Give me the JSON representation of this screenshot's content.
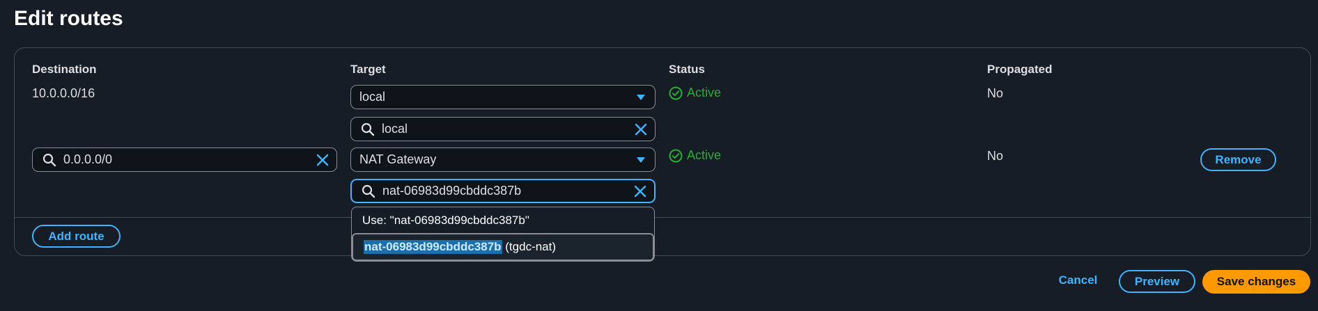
{
  "page": {
    "title": "Edit routes"
  },
  "columns": {
    "destination": "Destination",
    "target": "Target",
    "status": "Status",
    "propagated": "Propagated"
  },
  "routes": [
    {
      "destination": "10.0.0.0/16",
      "target_type": "local",
      "target_search": "local",
      "status": "Active",
      "propagated": "No"
    },
    {
      "destination": "0.0.0.0/0",
      "target_type": "NAT Gateway",
      "target_search": "nat-06983d99cbddc387b",
      "status": "Active",
      "propagated": "No",
      "remove_label": "Remove"
    }
  ],
  "dropdown": {
    "use_option": "Use: \"nat-06983d99cbddc387b\"",
    "match_text": "nat-06983d99cbddc387b",
    "match_suffix": " (tgdc-nat)"
  },
  "buttons": {
    "add_route": "Add route",
    "cancel": "Cancel",
    "preview": "Preview",
    "save_changes": "Save changes"
  },
  "colors": {
    "background": "#161d26",
    "accent": "#42b4ff",
    "status_active": "#29ad32",
    "primary": "#ff9900",
    "border": "#8c8c94"
  },
  "icons": {
    "search": "search-icon",
    "clear": "close-icon",
    "caret": "caret-down-icon",
    "status": "check-circle-icon"
  }
}
